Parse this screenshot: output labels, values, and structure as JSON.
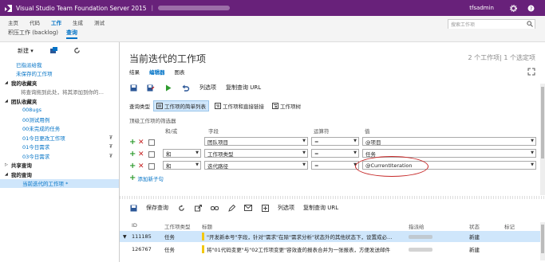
{
  "topbar": {
    "title": "Visual Studio Team Foundation Server 2015",
    "user": "tfsadmin",
    "icons": [
      "vs-logo-icon",
      "gear-icon",
      "help-icon"
    ]
  },
  "nav1": {
    "items": [
      "主页",
      "代码",
      "工作",
      "生成",
      "测试"
    ],
    "active": "工作"
  },
  "nav2": {
    "items": [
      "积压工作 (backlog)",
      "查询"
    ],
    "active": "查询"
  },
  "search": {
    "placeholder": "搜索工作项"
  },
  "sidebar": {
    "new_label": "新建",
    "items": [
      {
        "label": "已指派给我",
        "type": "link"
      },
      {
        "label": "未保存的工作项",
        "type": "link"
      },
      {
        "label": "我的收藏夹",
        "type": "head"
      },
      {
        "label": "将查询拖到此处，将其添加到你的…",
        "type": "note"
      },
      {
        "label": "团队收藏夹",
        "type": "head"
      },
      {
        "label": "008ugs",
        "type": "indent"
      },
      {
        "label": "00测试用例",
        "type": "indent"
      },
      {
        "label": "00未完成的任务",
        "type": "indent"
      },
      {
        "label": "01今日更改工作项",
        "type": "indent",
        "pin": "₮"
      },
      {
        "label": "01今日需求",
        "type": "indent",
        "pin": "₮"
      },
      {
        "label": "03今日需求",
        "type": "indent",
        "pin": "₮"
      },
      {
        "label": "共享查询",
        "type": "head"
      },
      {
        "label": "我的查询",
        "type": "head"
      },
      {
        "label": "当前迭代的工作项 *",
        "type": "selected"
      }
    ]
  },
  "main": {
    "title": "当前迭代的工作项",
    "count": "2 个工作项| 1 个选定项",
    "tabs": [
      "结果",
      "编辑器",
      "图表"
    ],
    "active_tab": "编辑器",
    "toolbar": {
      "columns_label": "列选项",
      "copy_url_label": "复制查询 URL"
    },
    "query_type_label": "查询类型",
    "query_types": [
      "工作项的简单列表",
      "工作项和直接链接",
      "工作项树"
    ],
    "selected_query_type": "工作项的简单列表",
    "filter_label": "顶级工作项的筛选器",
    "headers": {
      "andor": "和/或",
      "field": "字段",
      "operator": "运算符",
      "value": "值"
    },
    "clauses": [
      {
        "andor": "",
        "field": "团队项目",
        "operator": "=",
        "value": "@项目"
      },
      {
        "andor": "和",
        "field": "工作项类型",
        "operator": "=",
        "value": "任务"
      },
      {
        "andor": "和",
        "field": "迭代路径",
        "operator": "=",
        "value": "@CurrentIteration"
      }
    ],
    "add_clause": "添加新子句"
  },
  "results": {
    "toolbar": {
      "save_label": "保存查询",
      "columns_label": "列选项",
      "copy_url_label": "复制查询 URL"
    },
    "headers": {
      "id": "ID",
      "type": "工作项类型",
      "title": "标题",
      "assigned": "指派给",
      "state": "状态",
      "tags": "标记"
    },
    "rows": [
      {
        "id": "111185",
        "type": "任务",
        "title": "\"开发新本号\"字段，针对\"需求\"在除\"需求分析\"状态外的其他状态下，设置成必…",
        "state": "新建",
        "selected": true
      },
      {
        "id": "126767",
        "type": "任务",
        "title": "将\"01代码变更\"与\"02工作项变更\"容效查的报表合并为一张报表，方便发送邮件",
        "state": "新建",
        "selected": false
      }
    ]
  },
  "colors": {
    "topbar": "#68217a",
    "accent": "#0072c6",
    "selected": "#cfe6fb",
    "add": "#2e9b2e",
    "remove": "#c41f1f",
    "highlight": "#c62828"
  }
}
